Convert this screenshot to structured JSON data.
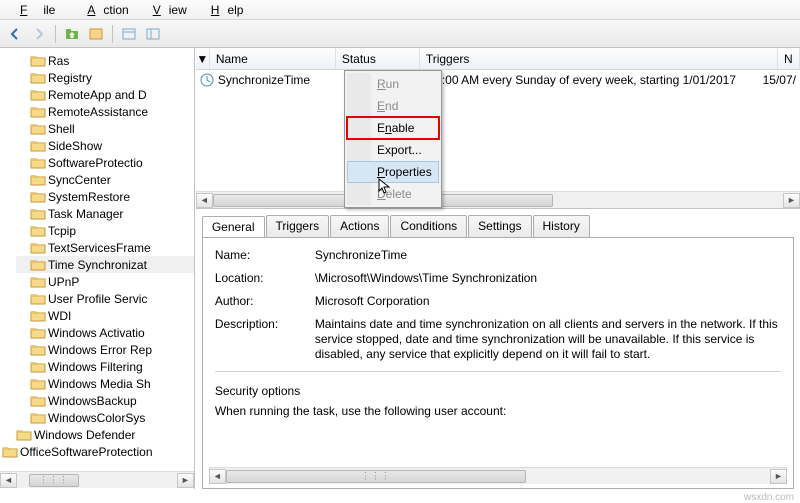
{
  "menubar": {
    "file": "File",
    "action": "Action",
    "view": "View",
    "help": "Help"
  },
  "tree": {
    "items": [
      {
        "label": "Ras",
        "indent": 1
      },
      {
        "label": "Registry",
        "indent": 1
      },
      {
        "label": "RemoteApp and D",
        "indent": 1
      },
      {
        "label": "RemoteAssistance",
        "indent": 1
      },
      {
        "label": "Shell",
        "indent": 1
      },
      {
        "label": "SideShow",
        "indent": 1
      },
      {
        "label": "SoftwareProtectio",
        "indent": 1
      },
      {
        "label": "SyncCenter",
        "indent": 1
      },
      {
        "label": "SystemRestore",
        "indent": 1
      },
      {
        "label": "Task Manager",
        "indent": 1
      },
      {
        "label": "Tcpip",
        "indent": 1
      },
      {
        "label": "TextServicesFrame",
        "indent": 1
      },
      {
        "label": "Time Synchronizat",
        "indent": 1,
        "sel": true
      },
      {
        "label": "UPnP",
        "indent": 1
      },
      {
        "label": "User Profile Servic",
        "indent": 1
      },
      {
        "label": "WDI",
        "indent": 1
      },
      {
        "label": "Windows Activatio",
        "indent": 1
      },
      {
        "label": "Windows Error Rep",
        "indent": 1
      },
      {
        "label": "Windows Filtering",
        "indent": 1
      },
      {
        "label": "Windows Media Sh",
        "indent": 1
      },
      {
        "label": "WindowsBackup",
        "indent": 1
      },
      {
        "label": "WindowsColorSys",
        "indent": 1
      },
      {
        "label": "Windows Defender",
        "indent": 0
      },
      {
        "label": "OfficeSoftwareProtection",
        "indent": -1
      }
    ]
  },
  "columns": {
    "name": "Name",
    "status": "Status",
    "triggers": "Triggers",
    "next": "N"
  },
  "task_row": {
    "name": "SynchronizeTime",
    "triggers_suffix": "at 1:00 AM every Sunday of every week, starting 1/01/2017",
    "date": "15/07/"
  },
  "ctx": {
    "run": "Run",
    "end": "End",
    "enable": "Enable",
    "export": "Export...",
    "properties": "Properties",
    "delete": "Delete"
  },
  "tabs": {
    "general": "General",
    "triggers": "Triggers",
    "actions": "Actions",
    "conditions": "Conditions",
    "settings": "Settings",
    "history": "History"
  },
  "details": {
    "name_lbl": "Name:",
    "name_val": "SynchronizeTime",
    "location_lbl": "Location:",
    "location_val": "\\Microsoft\\Windows\\Time Synchronization",
    "author_lbl": "Author:",
    "author_val": "Microsoft Corporation",
    "desc_lbl": "Description:",
    "desc_val": "Maintains date and time synchronization on all clients and servers in the network. If this service stopped, date and time synchronization will be unavailable. If this service is disabled, any service that explicitly depend on it will fail to start.",
    "sec_head": "Security options",
    "sec_text": "When running the task, use the following user account:"
  },
  "watermark": "wsxdn.com"
}
